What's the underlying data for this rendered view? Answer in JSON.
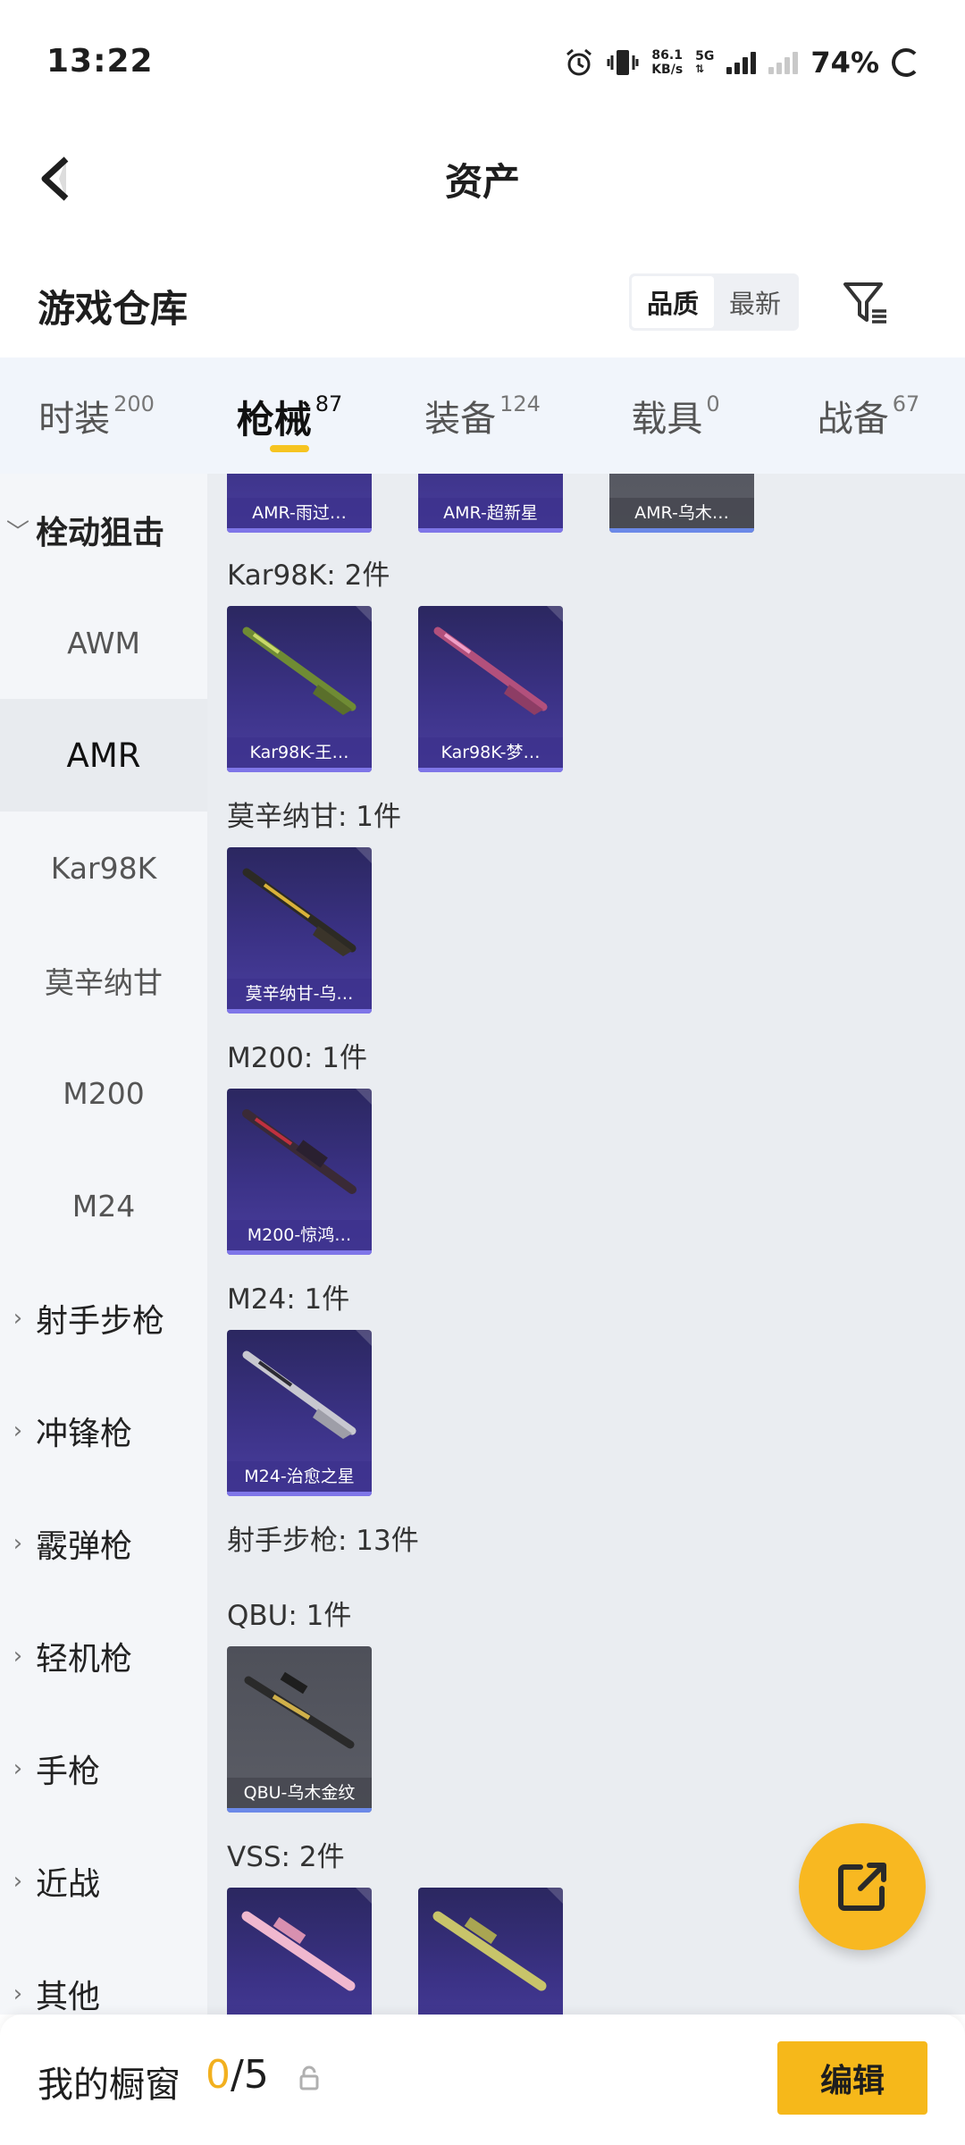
{
  "status_bar": {
    "time": "13:22",
    "net_speed_value": "86.1",
    "net_speed_unit": "KB/s",
    "network_type": "5G",
    "battery": "74%"
  },
  "nav": {
    "title": "资产"
  },
  "header": {
    "title": "游戏仓库",
    "sort_options": [
      "品质",
      "最新"
    ],
    "sort_active": "品质"
  },
  "tabs": [
    {
      "label": "时装",
      "count": "200"
    },
    {
      "label": "枪械",
      "count": "87",
      "active": true
    },
    {
      "label": "装备",
      "count": "124"
    },
    {
      "label": "载具",
      "count": "0"
    },
    {
      "label": "战备",
      "count": "67"
    }
  ],
  "sidebar": {
    "groups": [
      {
        "label": "栓动狙击",
        "open": true
      },
      {
        "label": "射手步枪"
      },
      {
        "label": "冲锋枪"
      },
      {
        "label": "霰弹枪"
      },
      {
        "label": "轻机枪"
      },
      {
        "label": "手枪"
      },
      {
        "label": "近战"
      },
      {
        "label": "其他"
      }
    ],
    "subitems": [
      {
        "label": "AWM"
      },
      {
        "label": "AMR",
        "active": true
      },
      {
        "label": "Kar98K"
      },
      {
        "label": "莫辛纳甘"
      },
      {
        "label": "M200"
      },
      {
        "label": "M24"
      }
    ]
  },
  "content": {
    "top_cards": [
      "AMR-雨过…",
      "AMR-超新星",
      "AMR-乌木…"
    ],
    "sections": [
      {
        "title": "Kar98K: 2件",
        "items": [
          "Kar98K-王…",
          "Kar98K-梦…"
        ]
      },
      {
        "title": "莫辛纳甘: 1件",
        "items": [
          "莫辛纳甘-乌…"
        ]
      },
      {
        "title": "M200: 1件",
        "items": [
          "M200-惊鸿…"
        ]
      },
      {
        "title": "M24: 1件",
        "items": [
          "M24-治愈之星"
        ]
      },
      {
        "title": "射手步枪: 13件",
        "items": []
      },
      {
        "title": "QBU: 1件",
        "items": [
          "QBU-乌木金纹"
        ]
      },
      {
        "title": "VSS: 2件",
        "items": []
      }
    ]
  },
  "bottom_bar": {
    "label": "我的橱窗",
    "count_current": "0",
    "count_total": "/5",
    "edit_label": "编辑"
  },
  "colors": {
    "accent": "#f6b81a",
    "card_purple": "#3b3286",
    "card_gray": "#5b5d66"
  }
}
